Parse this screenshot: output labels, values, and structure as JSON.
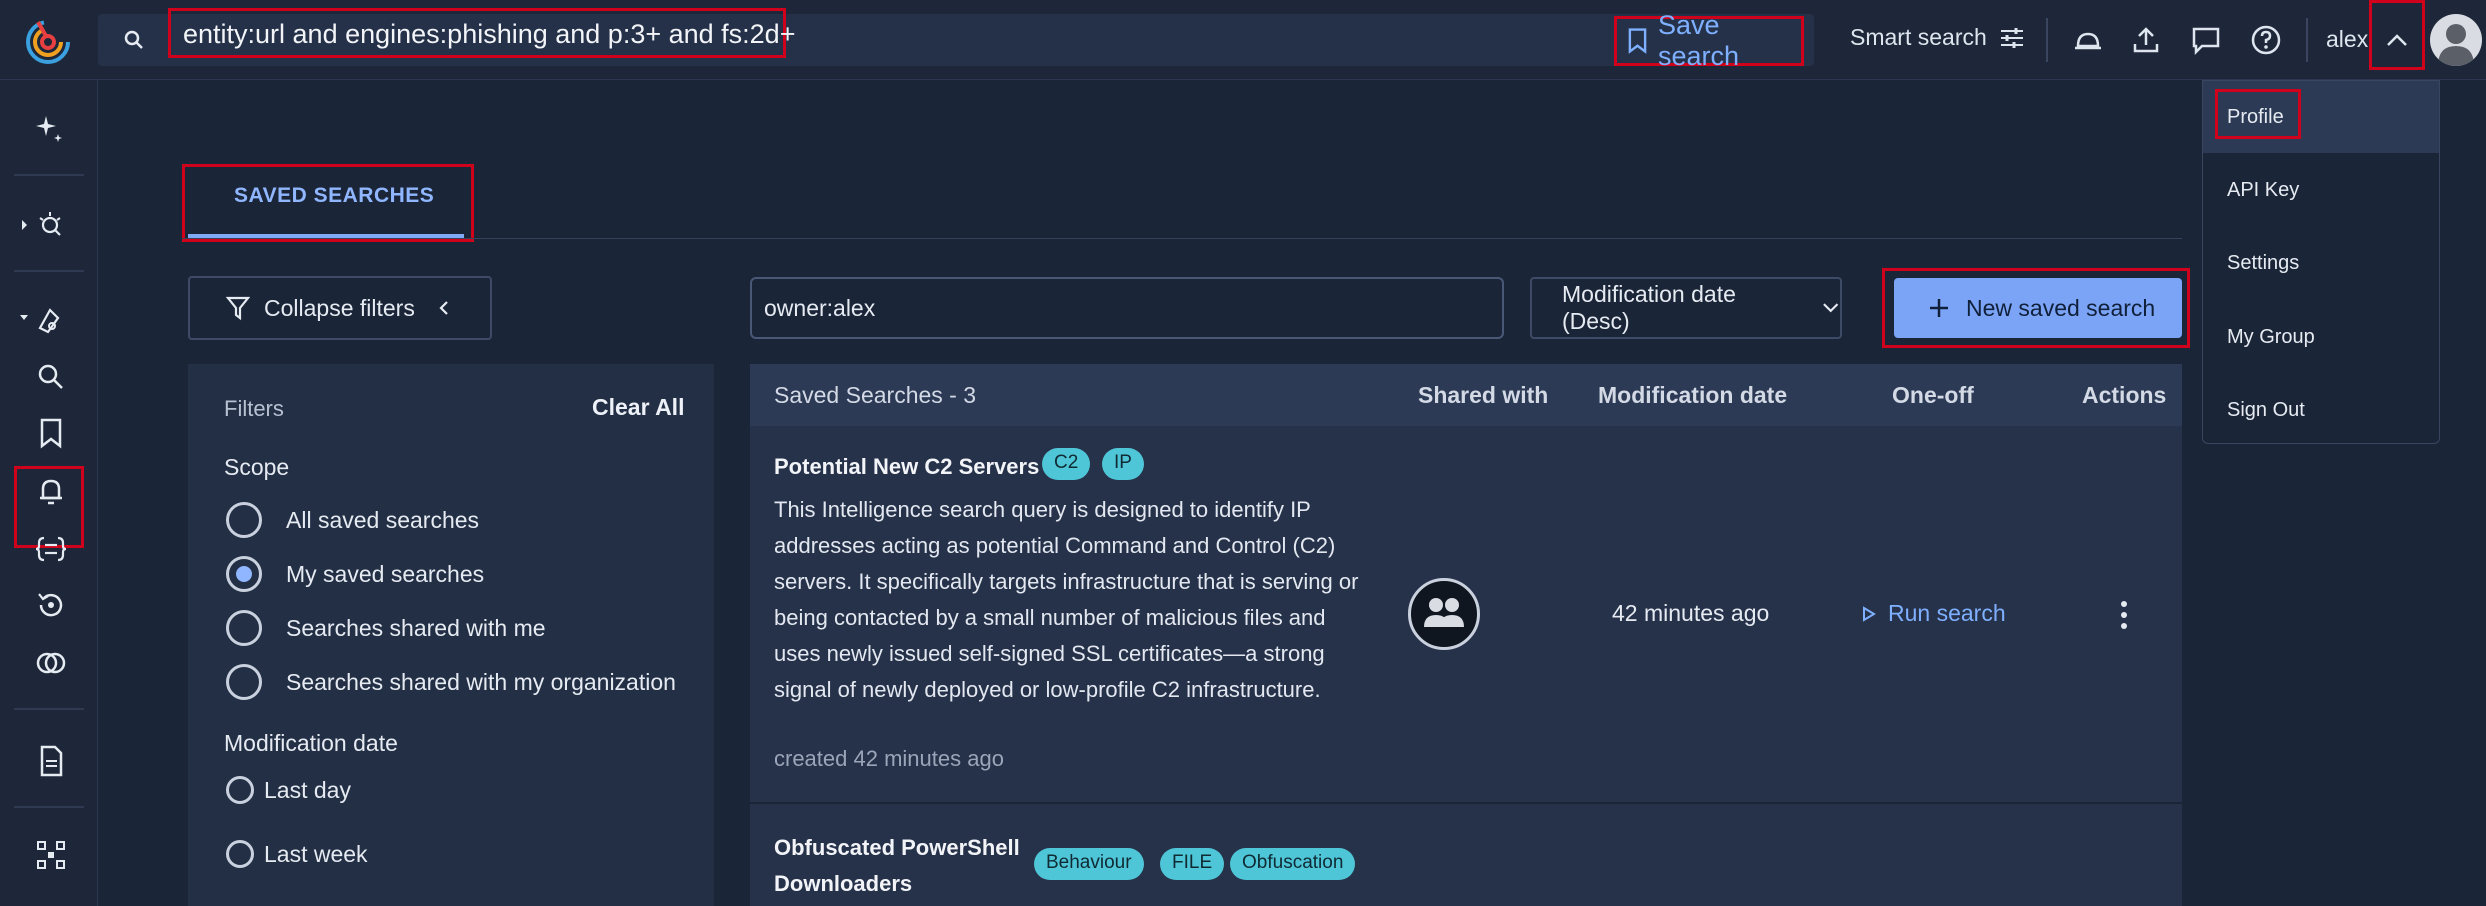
{
  "topbar": {
    "query": "entity:url and engines:phishing and p:3+ and fs:2d+",
    "save_search": "Save search",
    "smart_search": "Smart search",
    "user": "alex"
  },
  "tabs": [
    {
      "label": "SAVED SEARCHES",
      "active": true
    }
  ],
  "toolbar": {
    "collapse_filters": "Collapse filters",
    "owner_query": "owner:alex",
    "sort": "Modification date (Desc)",
    "new_saved_search": "New saved search"
  },
  "filters": {
    "title": "Filters",
    "clear_all": "Clear All",
    "scope_label": "Scope",
    "scope_options": [
      {
        "label": "All saved searches",
        "selected": false
      },
      {
        "label": "My saved searches",
        "selected": true
      },
      {
        "label": "Searches shared with me",
        "selected": false
      },
      {
        "label": "Searches shared with my organization",
        "selected": false
      }
    ],
    "modification_label": "Modification date",
    "modification_options": [
      {
        "label": "Last day",
        "selected": false
      },
      {
        "label": "Last week",
        "selected": false
      }
    ]
  },
  "table": {
    "columns": [
      "Saved Searches - 3",
      "Shared with",
      "Modification date",
      "One-off",
      "Actions"
    ],
    "rows": [
      {
        "title": "Potential New C2 Servers",
        "tags": [
          "C2",
          "IP"
        ],
        "description": "This Intelligence search query is designed to identify IP addresses acting as potential Command and Control (C2) servers. It specifically targets infrastructure that is serving or being contacted by a small number of malicious files and uses newly issued self-signed SSL certificates—a strong signal of newly deployed or low-profile C2 infrastructure.",
        "created": "created 42 minutes ago",
        "modified": "42 minutes ago",
        "action": "Run search"
      },
      {
        "title": "Obfuscated PowerShell Downloaders",
        "tags": [
          "Behaviour",
          "FILE",
          "Obfuscation"
        ]
      }
    ]
  },
  "user_menu": {
    "items": [
      "Profile",
      "API Key",
      "Settings",
      "My Group",
      "Sign Out"
    ]
  },
  "colors": {
    "accent": "#7ca4f6",
    "badge": "#4fc6d8",
    "highlight": "#d0021b"
  }
}
